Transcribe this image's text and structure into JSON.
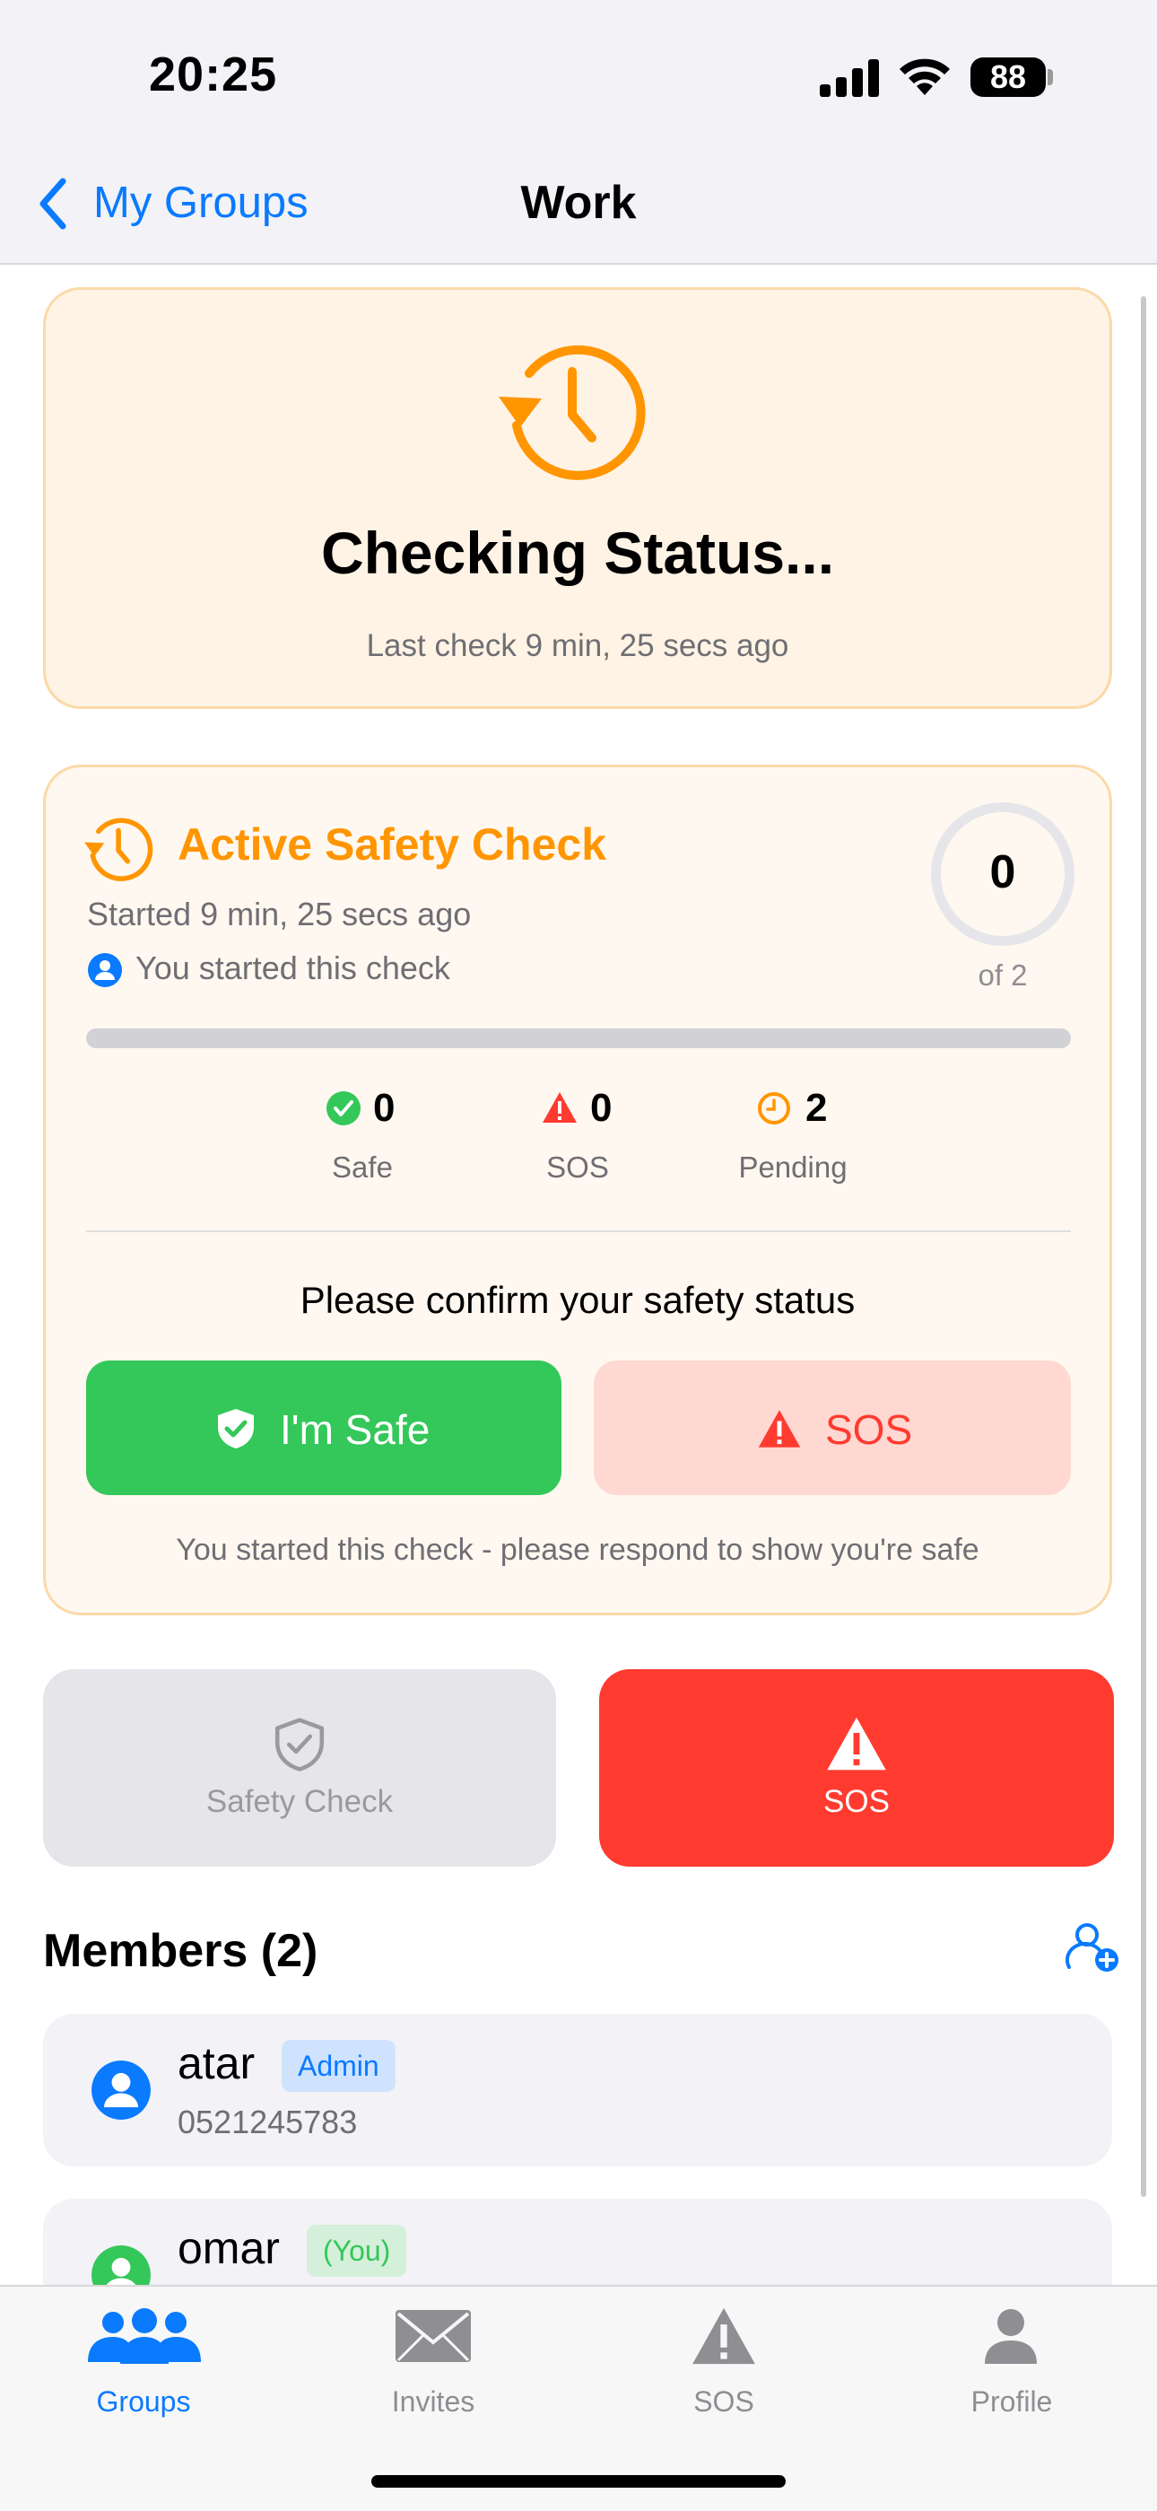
{
  "status_bar": {
    "time": "20:25",
    "battery": "88"
  },
  "nav": {
    "back_label": "My Groups",
    "title": "Work"
  },
  "status_card": {
    "title": "Checking Status...",
    "subtitle": "Last check 9 min, 25 secs ago"
  },
  "active_check": {
    "title": "Active Safety Check",
    "started": "Started 9 min, 25 secs ago",
    "starter": "You started this check",
    "responded_count": "0",
    "total_label": "of 2",
    "progress_fraction": 0,
    "stats": [
      {
        "value": "0",
        "label": "Safe",
        "color": "#34c759"
      },
      {
        "value": "0",
        "label": "SOS",
        "color": "#ff3b30"
      },
      {
        "value": "2",
        "label": "Pending",
        "color": "#ff9500"
      }
    ],
    "prompt": "Please confirm your safety status",
    "safe_button": "I'm Safe",
    "sos_button": "SOS",
    "note": "You started this check - please respond to show you're safe"
  },
  "actions": {
    "safety_check_label": "Safety Check",
    "sos_label": "SOS"
  },
  "members": {
    "title": "Members (2)",
    "items": [
      {
        "name": "atar",
        "badge": "Admin",
        "phone": "0521245783",
        "avatar_color": "#0a7aff"
      },
      {
        "name": "omar",
        "badge": "(You)",
        "phone": "",
        "avatar_color": "#34c759"
      }
    ]
  },
  "tabs": [
    {
      "label": "Groups",
      "icon": "groups-icon",
      "active": true
    },
    {
      "label": "Invites",
      "icon": "envelope-icon",
      "active": false
    },
    {
      "label": "SOS",
      "icon": "warning-triangle-icon",
      "active": false
    },
    {
      "label": "Profile",
      "icon": "person-icon",
      "active": false
    }
  ],
  "colors": {
    "accent": "#0a7aff",
    "warning": "#ff9500",
    "danger": "#ff3b30",
    "safe": "#34c759"
  }
}
